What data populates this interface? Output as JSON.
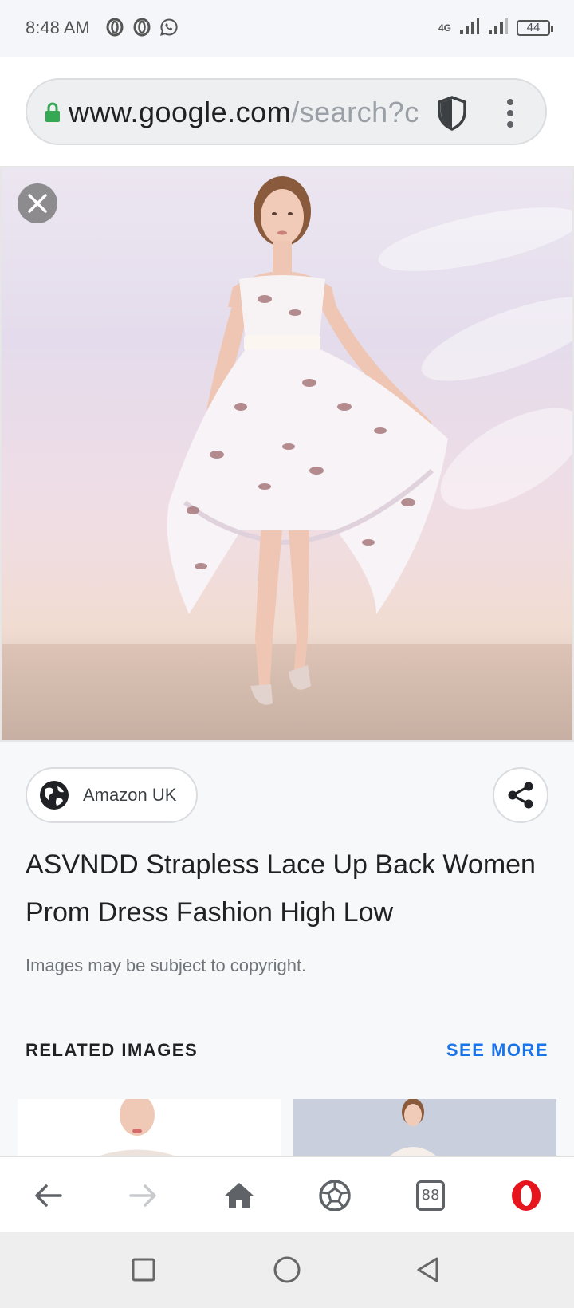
{
  "status_bar": {
    "time": "8:48 AM",
    "network": "4G",
    "battery": "44",
    "icons": [
      "opera-icon",
      "opera-icon",
      "whatsapp-icon",
      "signal-icon",
      "signal-icon",
      "battery-icon"
    ]
  },
  "browser": {
    "url_domain": "www.google.com",
    "url_path": "/search?c",
    "icons": [
      "lock-icon",
      "shield-icon",
      "more-vert-icon"
    ]
  },
  "image_viewer": {
    "close_icon": "close-icon",
    "source_label": "Amazon UK",
    "source_icon": "globe-icon",
    "share_icon": "share-icon",
    "title": "ASVNDD Strapless Lace Up Back Women Prom Dress Fashion High Low",
    "copyright_note": "Images may be subject to copyright.",
    "related_heading": "RELATED IMAGES",
    "see_more": "SEE MORE"
  },
  "browser_bar": {
    "tab_count": "88",
    "icons": [
      "back-arrow-icon",
      "forward-arrow-icon",
      "home-icon",
      "speed-dial-icon",
      "tabs-icon",
      "opera-menu-icon"
    ]
  },
  "colors": {
    "accent": "#1a73e8",
    "opera_red": "#e5141d",
    "lock_green": "#34a853"
  }
}
